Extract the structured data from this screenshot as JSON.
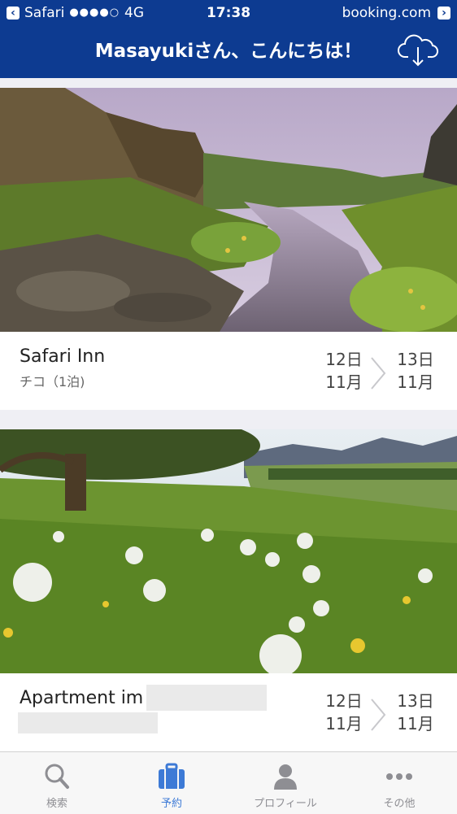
{
  "status_bar": {
    "back_app": "Safari",
    "signal": "●●●●○",
    "network": "4G",
    "time": "17:38",
    "site": "booking.com"
  },
  "header": {
    "title": "Masayukiさん、こんにちは！",
    "cloud_icon": "cloud-download-icon"
  },
  "bookings": [
    {
      "name": "Safari Inn",
      "subtitle": "チコ（1泊)",
      "checkin": {
        "day": "12日",
        "month": "11月"
      },
      "checkout": {
        "day": "13日",
        "month": "11月"
      }
    },
    {
      "name": "Apartment im",
      "subtitle": "",
      "checkin": {
        "day": "12日",
        "month": "11月"
      },
      "checkout": {
        "day": "13日",
        "month": "11月"
      }
    }
  ],
  "tabs": [
    {
      "label": "検索",
      "icon": "search-icon"
    },
    {
      "label": "予約",
      "icon": "suitcase-icon"
    },
    {
      "label": "プロフィール",
      "icon": "person-icon"
    },
    {
      "label": "その他",
      "icon": "more-icon"
    }
  ],
  "colors": {
    "brand_blue": "#0d3b91",
    "active_tab": "#3d7ad6",
    "inactive_tab": "#8e8e93"
  }
}
